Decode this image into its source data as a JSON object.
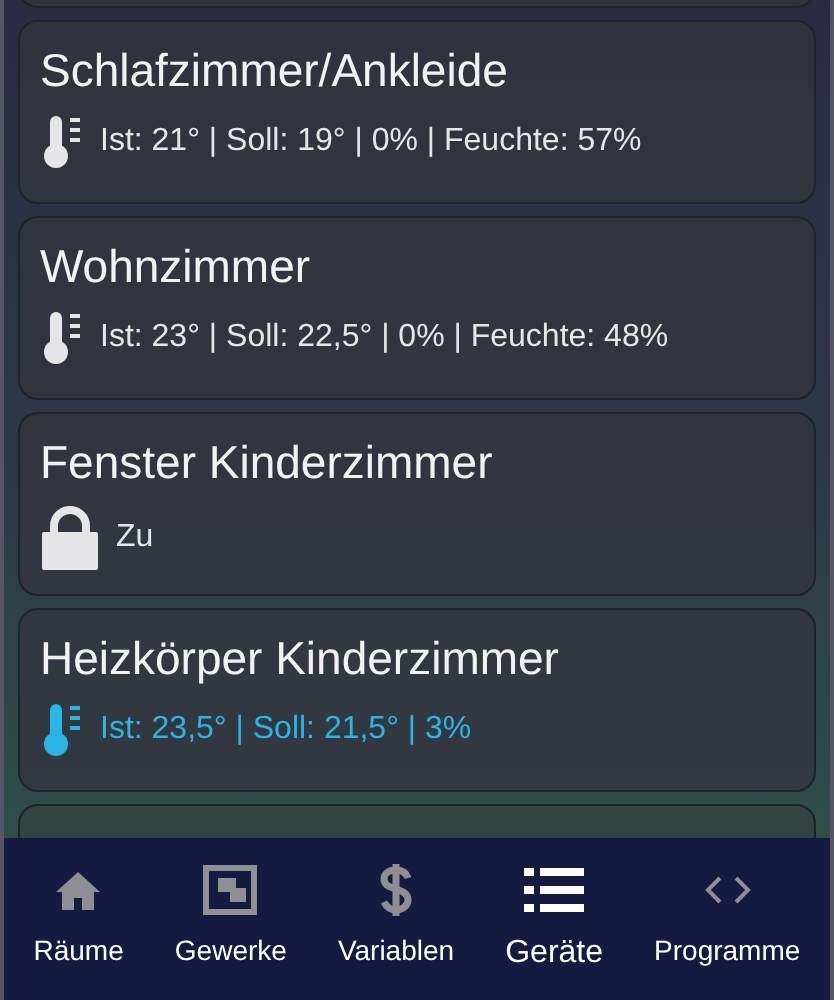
{
  "devices": [
    {
      "name": "Schlafzimmer/Ankleide",
      "kind": "thermostat",
      "active": false,
      "status": "Ist: 21° | Soll: 19° | 0% | Feuchte: 57%"
    },
    {
      "name": "Wohnzimmer",
      "kind": "thermostat",
      "active": false,
      "status": "Ist: 23° | Soll: 22,5° | 0% | Feuchte: 48%"
    },
    {
      "name": "Fenster Kinderzimmer",
      "kind": "lock",
      "active": false,
      "status": "Zu"
    },
    {
      "name": "Heizkörper Kinderzimmer",
      "kind": "thermostat",
      "active": true,
      "status": "Ist: 23,5° | Soll: 21,5° | 3%"
    }
  ],
  "nav": [
    {
      "label": "Räume",
      "kind": "home",
      "selected": false
    },
    {
      "label": "Gewerke",
      "kind": "frame",
      "selected": false
    },
    {
      "label": "Variablen",
      "kind": "dollar",
      "selected": false
    },
    {
      "label": "Geräte",
      "kind": "list",
      "selected": true
    },
    {
      "label": "Programme",
      "kind": "code",
      "selected": false
    }
  ]
}
